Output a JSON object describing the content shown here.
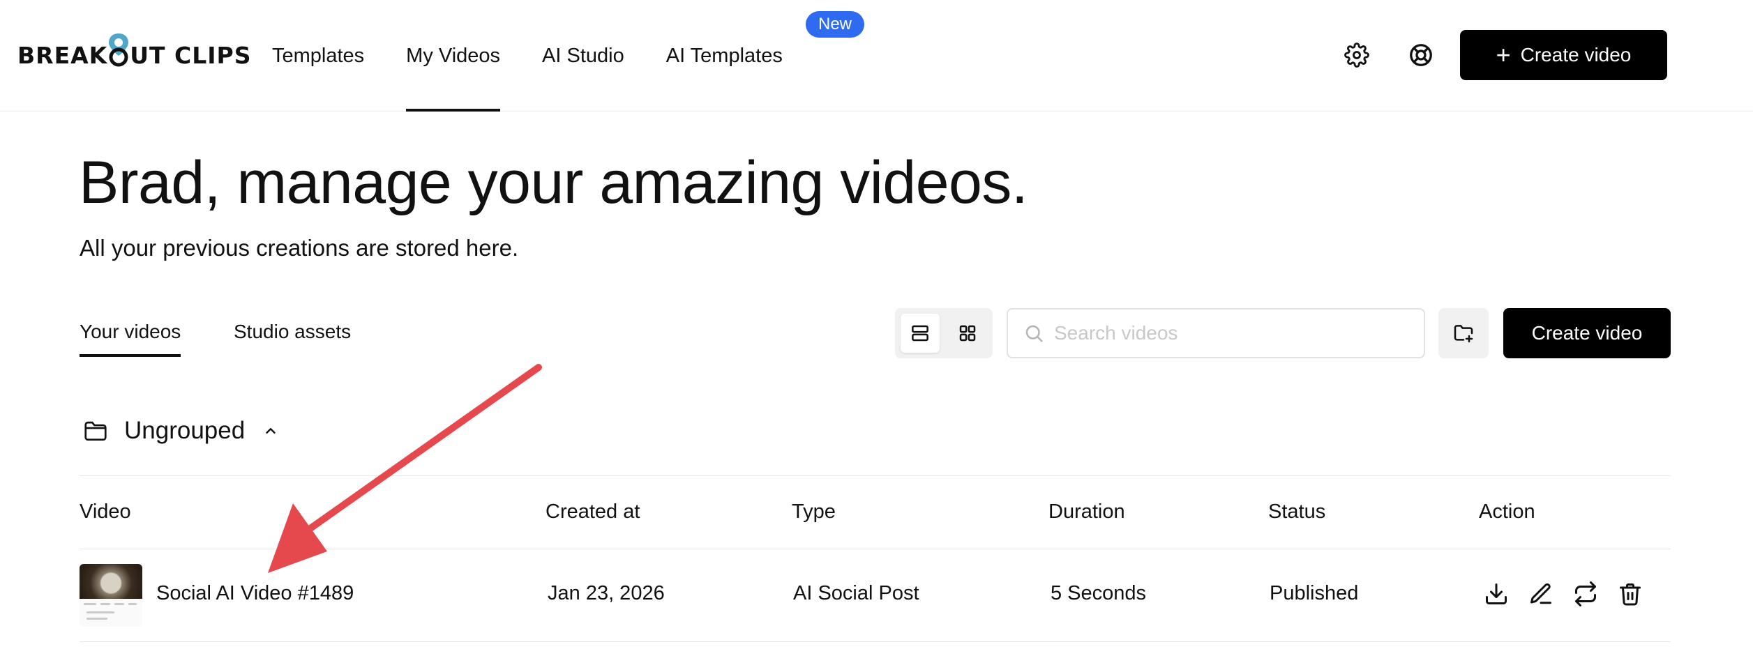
{
  "brand": {
    "logo_text_left": "BREAK",
    "logo_text_right": "UT CLIPS"
  },
  "nav": {
    "items": [
      {
        "label": "Templates"
      },
      {
        "label": "My Videos"
      },
      {
        "label": "AI Studio"
      },
      {
        "label": "AI Templates"
      }
    ],
    "badge": "New"
  },
  "header": {
    "create_button": "Create video"
  },
  "hero": {
    "heading": "Brad, manage your amazing videos.",
    "subheading": "All your previous creations are stored here."
  },
  "tabs": [
    {
      "label": "Your videos",
      "active": true
    },
    {
      "label": "Studio assets",
      "active": false
    }
  ],
  "toolbar": {
    "search_placeholder": "Search videos",
    "create_button": "Create video"
  },
  "group": {
    "name": "Ungrouped"
  },
  "table": {
    "columns": [
      "Video",
      "Created at",
      "Type",
      "Duration",
      "Status",
      "Action"
    ],
    "rows": [
      {
        "video": "Social AI Video #1489",
        "created_at": "Jan 23, 2026",
        "type": "AI Social Post",
        "duration": "5 Seconds",
        "status": "Published"
      }
    ]
  },
  "icons": {
    "header": [
      "settings-gear-icon",
      "help-lifebuoy-icon"
    ],
    "actions": [
      "download-icon",
      "edit-pen-icon",
      "refresh-icon",
      "trash-icon"
    ]
  },
  "colors": {
    "accent_badge": "#2f6bf0",
    "primary_button": "#000000",
    "annotation_arrow": "#e5484d"
  }
}
